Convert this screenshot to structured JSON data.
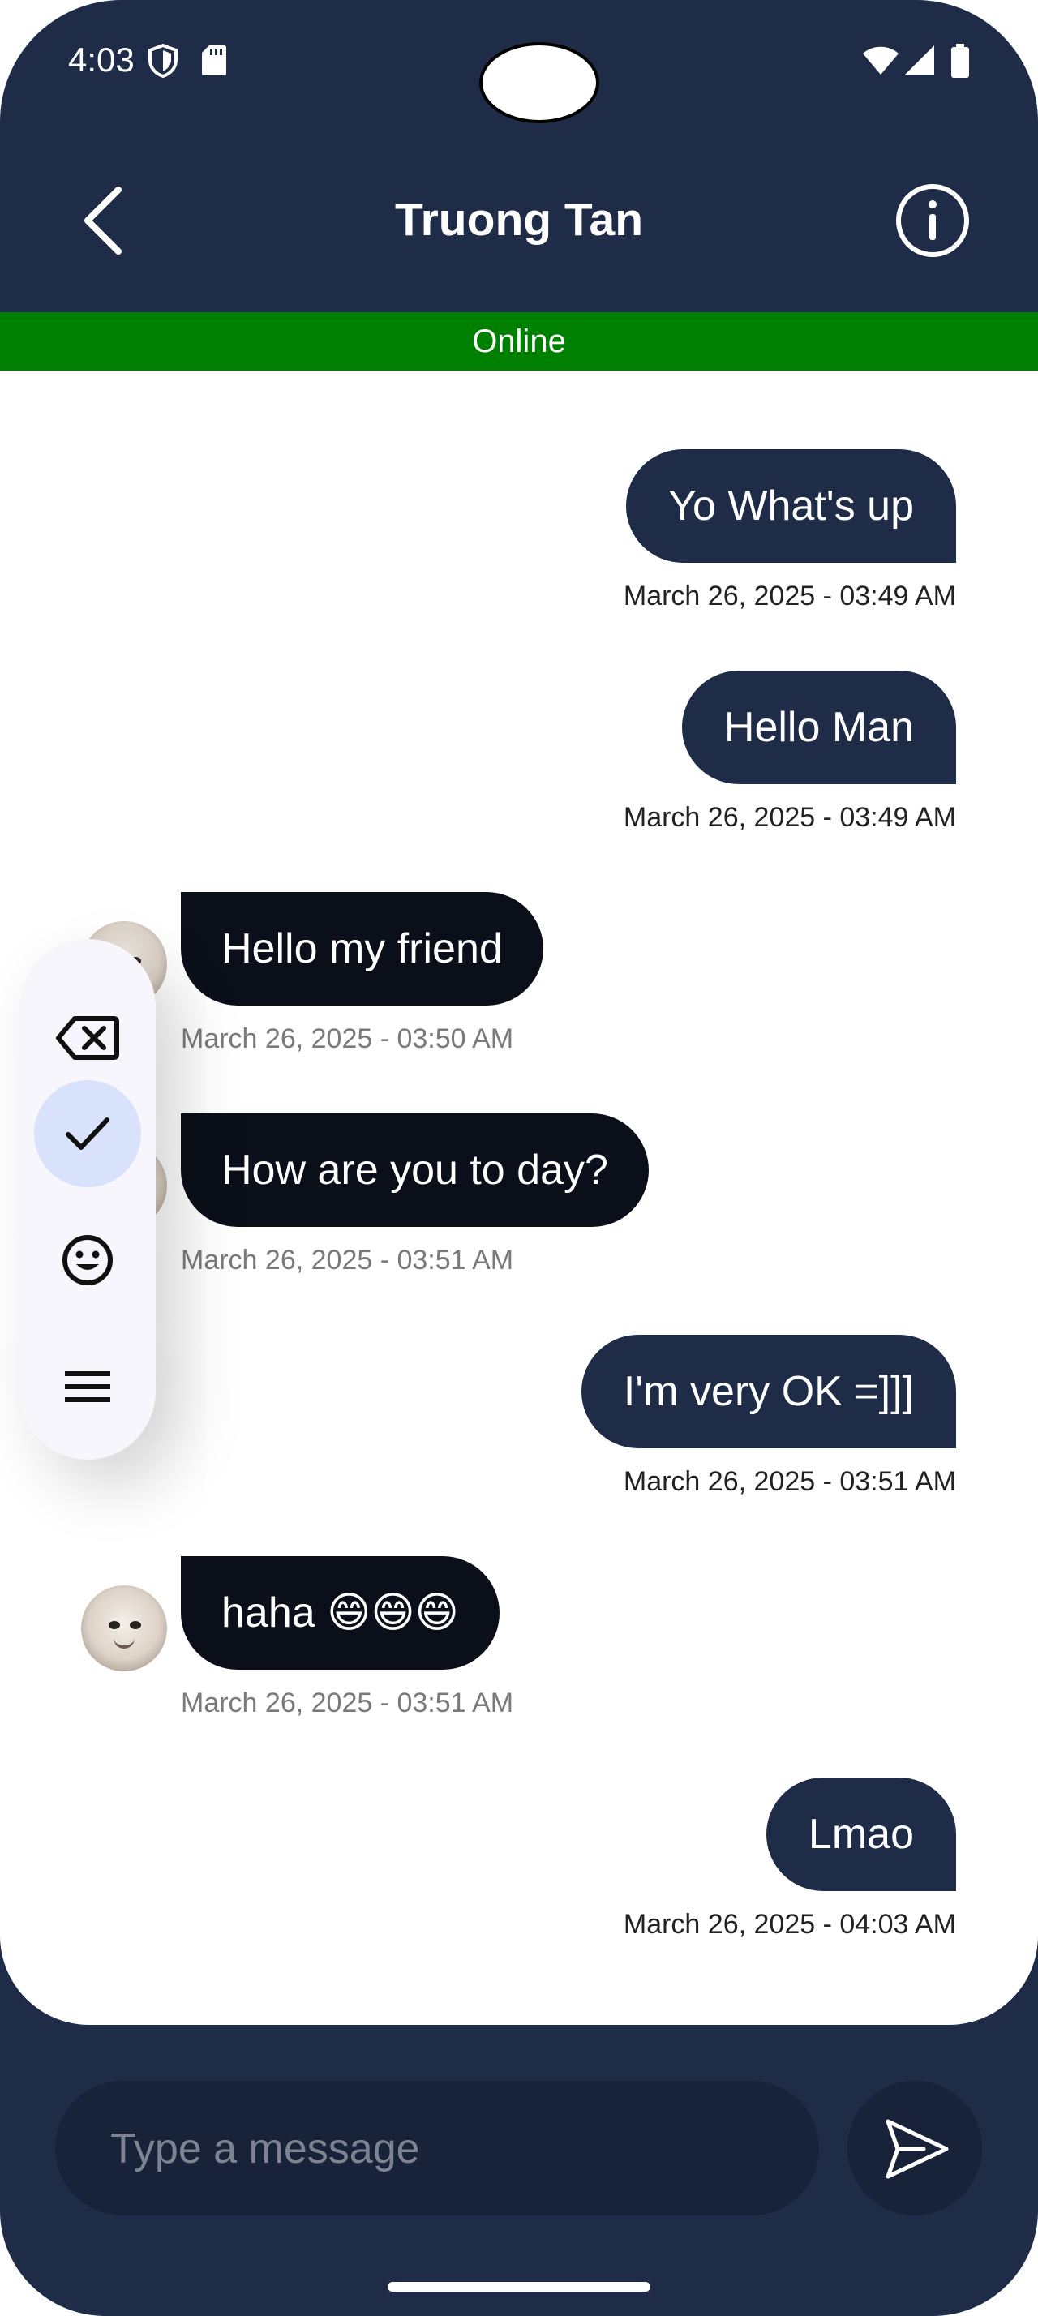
{
  "status_bar": {
    "time": "4:03",
    "icons": [
      "shield-icon",
      "sd-card-icon",
      "wifi-icon",
      "signal-icon",
      "battery-icon"
    ]
  },
  "header": {
    "title": "Truong Tan",
    "back_icon": "chevron-left-icon",
    "info_icon": "info-icon",
    "status": "Online",
    "status_color": "#008000",
    "background_color": "#1e2c48"
  },
  "messages": [
    {
      "direction": "out",
      "text": "Yo What's up",
      "time": "March 26, 2025 - 03:49 AM"
    },
    {
      "direction": "out",
      "text": "Hello Man",
      "time": "March 26, 2025 - 03:49 AM"
    },
    {
      "direction": "in",
      "text": "Hello my friend",
      "time": "March 26, 2025 - 03:50 AM"
    },
    {
      "direction": "in",
      "text": "How are you to day?",
      "time": "March 26, 2025 - 03:51 AM"
    },
    {
      "direction": "out",
      "text": "I'm very OK =]]]",
      "time": "March 26, 2025 - 03:51 AM"
    },
    {
      "direction": "in",
      "text": "haha 😄😄😄",
      "time": "March 26, 2025 - 03:51 AM"
    },
    {
      "direction": "out",
      "text": "Lmao",
      "time": "March 26, 2025 - 04:03 AM"
    }
  ],
  "floating_toolbar": {
    "tools": [
      {
        "icon": "backspace-icon",
        "active": false
      },
      {
        "icon": "check-icon",
        "active": true
      },
      {
        "icon": "emoji-icon",
        "active": false
      },
      {
        "icon": "menu-icon",
        "active": false
      }
    ]
  },
  "composer": {
    "placeholder": "Type a message",
    "value": "",
    "send_icon": "send-icon"
  }
}
